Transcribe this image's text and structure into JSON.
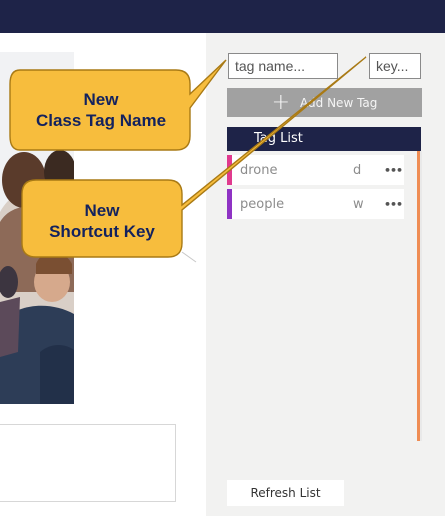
{
  "image_panel": {
    "text_box_value": ""
  },
  "tag_panel": {
    "tag_name_placeholder": "tag name...",
    "key_placeholder": "key...",
    "add_button_label": "Add New Tag",
    "add_button_icon": "plus-icon",
    "list_title": "Tag List",
    "tags": [
      {
        "name": "drone",
        "key": "d",
        "color": "#e03a8e",
        "more": "•••"
      },
      {
        "name": "people",
        "key": "w",
        "color": "#8f33c4",
        "more": "•••"
      }
    ],
    "refresh_label": "Refresh List",
    "scroll_accent": "#ef8d54"
  },
  "callouts": [
    {
      "line1": "New",
      "line2": "Class Tag Name"
    },
    {
      "line1": "New",
      "line2": "Shortcut Key"
    }
  ],
  "colors": {
    "top_bar": "#1e2348",
    "callout_fill": "#f7bd3d",
    "callout_text": "#13225e"
  }
}
